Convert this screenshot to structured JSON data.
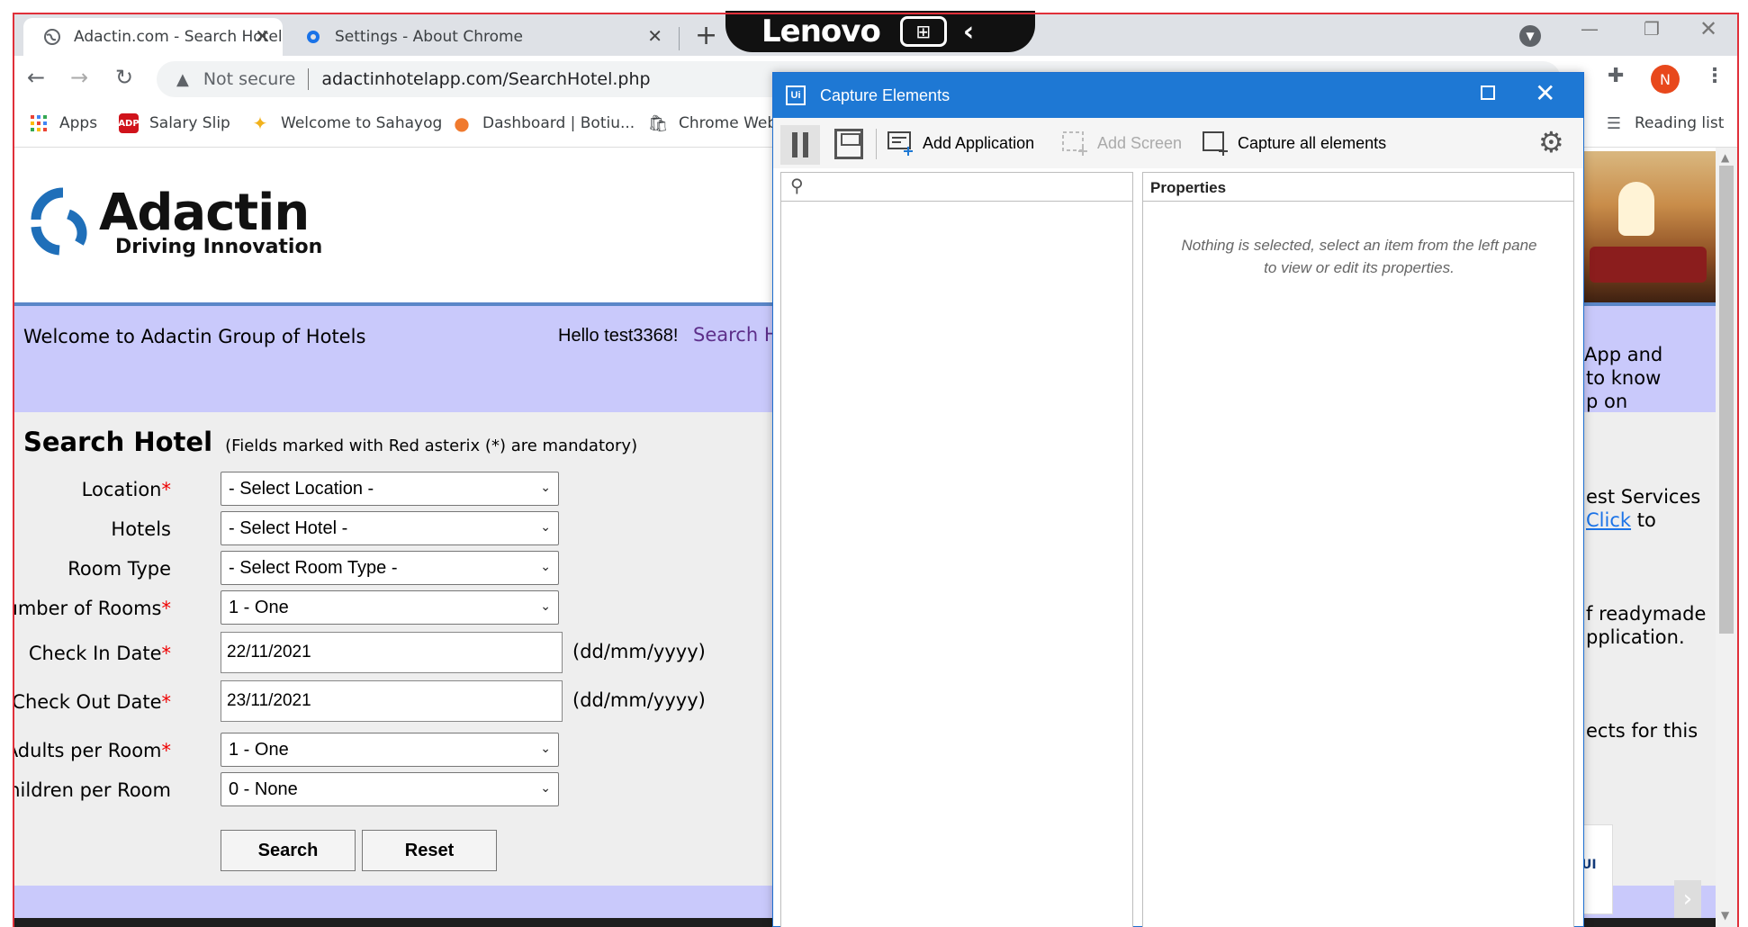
{
  "browser": {
    "tabs": [
      {
        "title": "Adactin.com - Search Hotel",
        "active": true
      },
      {
        "title": "Settings - About Chrome",
        "active": false
      }
    ],
    "overlay_logo": "Lenovo",
    "address": {
      "security": "Not secure",
      "url": "adactinhotelapp.com/SearchHotel.php"
    },
    "profile_initial": "N",
    "bookmarks": [
      {
        "label": "Apps",
        "icon": "apps-grid-icon"
      },
      {
        "label": "Salary Slip",
        "icon": "adp-icon"
      },
      {
        "label": "Welcome to Sahayog",
        "icon": "sahayog-icon"
      },
      {
        "label": "Dashboard | Botiu...",
        "icon": "chat-bubble-icon"
      },
      {
        "label": "Chrome Web",
        "icon": "webstore-icon"
      }
    ],
    "reading_list": "Reading list"
  },
  "site": {
    "brand": "Adactin",
    "tagline": "Driving Innovation",
    "welcome": "Welcome to Adactin Group of Hotels",
    "hello": "Hello test3368!",
    "search_link": "Search H",
    "right_snippets": {
      "line1": "App and",
      "line2": "to know",
      "line3": "p on",
      "line4": "est Services",
      "link": "Click",
      "line5_suffix": "to",
      "line6": "f readymade",
      "line7": "pplication.",
      "line8": "ects for this"
    },
    "ad_text": "UI"
  },
  "form": {
    "title": "Search Hotel",
    "note": "(Fields marked with Red asterix (*) are mandatory)",
    "fields": {
      "location": {
        "label": "Location",
        "value": "- Select Location -"
      },
      "hotels": {
        "label": "Hotels",
        "value": "- Select Hotel -"
      },
      "room_type": {
        "label": "Room Type",
        "value": "- Select Room Type -"
      },
      "rooms": {
        "label": "Number of Rooms",
        "value": "1 - One"
      },
      "checkin": {
        "label": "Check In Date",
        "value": "22/11/2021",
        "hint": "(dd/mm/yyyy)"
      },
      "checkout": {
        "label": "Check Out Date",
        "value": "23/11/2021",
        "hint": "(dd/mm/yyyy)"
      },
      "adults": {
        "label": "Adults per Room",
        "value": "1 - One"
      },
      "children": {
        "label": "Children per Room",
        "value": "0 - None"
      }
    },
    "asterisk": "*",
    "search_label": "Search",
    "reset_label": "Reset"
  },
  "dialog": {
    "title": "Capture Elements",
    "logo": "Ui",
    "tools": {
      "add_application": "Add Application",
      "add_screen": "Add Screen",
      "capture_all": "Capture all elements"
    },
    "properties_header": "Properties",
    "empty_message": "Nothing is selected, select an item from the left pane to view or edit its properties."
  },
  "colors": {
    "chrome_accent": "#1e78d4",
    "site_band": "#c9c9fb",
    "required": "#e00000"
  }
}
